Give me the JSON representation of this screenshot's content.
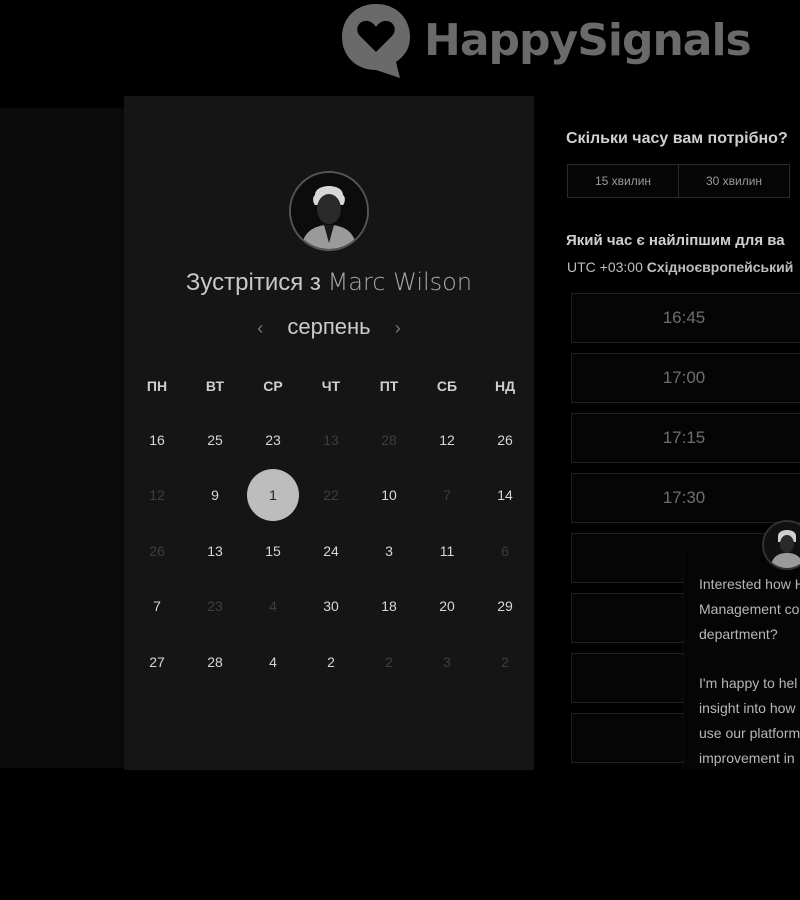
{
  "header": {
    "brand": "HappySignals",
    "logo_icon": "heart-speech-bubble-icon"
  },
  "booking": {
    "title_prefix": "Зустрітися з",
    "host_name": "Marc Wilson",
    "month": "серпень",
    "prev_icon": "chevron-left-icon",
    "next_icon": "chevron-right-icon",
    "weekdays": [
      "ПН",
      "ВТ",
      "СР",
      "ЧТ",
      "ПТ",
      "СБ",
      "НД"
    ],
    "weeks": [
      [
        {
          "d": "16",
          "dim": false
        },
        {
          "d": "25",
          "dim": false
        },
        {
          "d": "23",
          "dim": false
        },
        {
          "d": "13",
          "dim": true
        },
        {
          "d": "28",
          "dim": true
        },
        {
          "d": "12",
          "dim": false
        },
        {
          "d": "26",
          "dim": false
        }
      ],
      [
        {
          "d": "12",
          "dim": true
        },
        {
          "d": "9",
          "dim": false
        },
        {
          "d": "1",
          "dim": false,
          "selected": true
        },
        {
          "d": "22",
          "dim": true
        },
        {
          "d": "10",
          "dim": false
        },
        {
          "d": "7",
          "dim": true
        },
        {
          "d": "14",
          "dim": false
        }
      ],
      [
        {
          "d": "26",
          "dim": true
        },
        {
          "d": "13",
          "dim": false
        },
        {
          "d": "15",
          "dim": false
        },
        {
          "d": "24",
          "dim": false
        },
        {
          "d": "3",
          "dim": false
        },
        {
          "d": "11",
          "dim": false
        },
        {
          "d": "6",
          "dim": true
        }
      ],
      [
        {
          "d": "7",
          "dim": false
        },
        {
          "d": "23",
          "dim": true
        },
        {
          "d": "4",
          "dim": true
        },
        {
          "d": "30",
          "dim": false
        },
        {
          "d": "18",
          "dim": false
        },
        {
          "d": "20",
          "dim": false
        },
        {
          "d": "29",
          "dim": false
        }
      ],
      [
        {
          "d": "27",
          "dim": false
        },
        {
          "d": "28",
          "dim": false
        },
        {
          "d": "4",
          "dim": false
        },
        {
          "d": "2",
          "dim": false
        },
        {
          "d": "2",
          "dim": true
        },
        {
          "d": "3",
          "dim": true
        },
        {
          "d": "2",
          "dim": true
        }
      ]
    ]
  },
  "duration": {
    "question": "Скільки часу вам потрібно?",
    "options": [
      "15 хвилин",
      "30 хвилин"
    ]
  },
  "time": {
    "question": "Який час є найліпшим для ва",
    "timezone_offset": "UTC +03:00",
    "timezone_name": "Східноєвропейський",
    "slots": [
      "16:45",
      "17:00",
      "17:15",
      "17:30",
      "",
      "",
      "",
      ""
    ]
  },
  "chat": {
    "message": "Interested how H\nManagement co\ndepartment?\n\nI'm happy to hel\ninsight into how\nuse our platform\nimprovement in\nproductivity."
  }
}
